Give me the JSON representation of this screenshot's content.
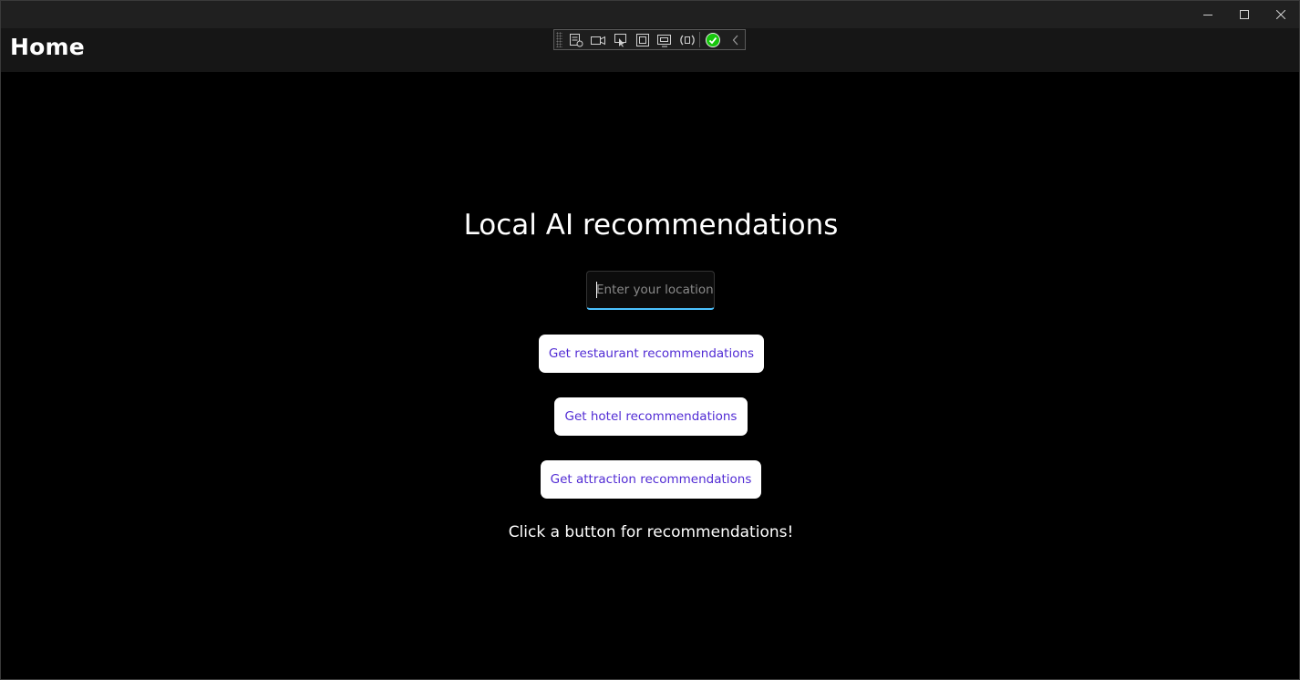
{
  "window": {
    "controls": {
      "minimize_icon": "minimize-icon",
      "maximize_icon": "maximize-icon",
      "close_icon": "close-icon"
    }
  },
  "navbar": {
    "title": "Home"
  },
  "debug_toolbar": {
    "icons": [
      "live-visual-tree-icon",
      "record-video-icon",
      "select-element-icon",
      "display-layout-adorners-icon",
      "track-focus-icon",
      "hot-reload-icon",
      "binding-check-icon",
      "collapse-chevron-icon"
    ],
    "status_color": "#16c60c"
  },
  "main": {
    "heading": "Local AI recommendations",
    "location_input": {
      "value": "",
      "placeholder": "Enter your location"
    },
    "buttons": {
      "restaurant": "Get restaurant recommendations",
      "hotel": "Get hotel recommendations",
      "attraction": "Get attraction recommendations"
    },
    "status_text": "Click a button for recommendations!"
  },
  "colors": {
    "background": "#000000",
    "navbar": "#161616",
    "button_text": "#512bd4",
    "input_accent": "#4cc2ff"
  }
}
